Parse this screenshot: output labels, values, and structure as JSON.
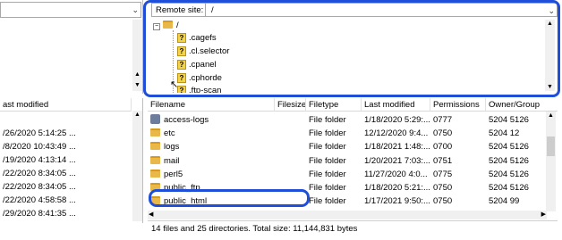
{
  "remote": {
    "label": "Remote site:",
    "path": "/",
    "tree": {
      "root": "/",
      "items": [
        ".cagefs",
        ".cl.selector",
        ".cpanel",
        ".cphorde",
        ".ftp-scan"
      ]
    }
  },
  "local": {
    "header": "ast modified",
    "rows": [
      "/26/2020 5:14:25 ...",
      "/8/2020 10:43:49 ...",
      "/19/2020 4:13:14 ...",
      "/22/2020 8:34:05 ...",
      "/22/2020 8:34:05 ...",
      "/22/2020 4:58:58 ...",
      "/29/2020 8:41:35 ..."
    ]
  },
  "files": {
    "columns": [
      "Filename",
      "Filesize",
      "Filetype",
      "Last modified",
      "Permissions",
      "Owner/Group"
    ],
    "rows": [
      {
        "name": "access-logs",
        "size": "",
        "type": "File folder",
        "modified": "1/18/2020 5:29:...",
        "perms": "0777",
        "owner": "5204 5126",
        "icon": "link-folder-icon"
      },
      {
        "name": "etc",
        "size": "",
        "type": "File folder",
        "modified": "12/12/2020 9:4...",
        "perms": "0750",
        "owner": "5204 12",
        "icon": "folder-icon"
      },
      {
        "name": "logs",
        "size": "",
        "type": "File folder",
        "modified": "1/18/2021 1:48:...",
        "perms": "0700",
        "owner": "5204 5126",
        "icon": "folder-icon"
      },
      {
        "name": "mail",
        "size": "",
        "type": "File folder",
        "modified": "1/20/2021 7:03:...",
        "perms": "0751",
        "owner": "5204 5126",
        "icon": "folder-icon"
      },
      {
        "name": "perl5",
        "size": "",
        "type": "File folder",
        "modified": "11/27/2020 4:0...",
        "perms": "0775",
        "owner": "5204 5126",
        "icon": "folder-icon"
      },
      {
        "name": "public_ftp",
        "size": "",
        "type": "File folder",
        "modified": "1/18/2020 5:21:...",
        "perms": "0750",
        "owner": "5204 5126",
        "icon": "folder-icon"
      },
      {
        "name": "public_html",
        "size": "",
        "type": "File folder",
        "modified": "1/17/2021 9:50:...",
        "perms": "0750",
        "owner": "5204 99",
        "icon": "folder-icon"
      }
    ]
  },
  "status": "14 files and 25 directories. Total size: 11,144,831 bytes",
  "colors": {
    "highlight": "#1f4fd8",
    "folder": "#e8b84a"
  }
}
